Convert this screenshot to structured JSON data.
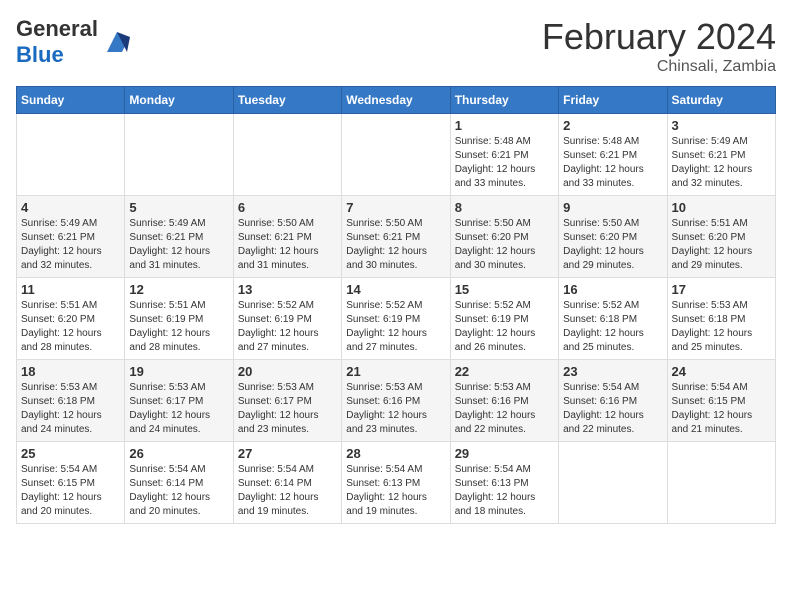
{
  "header": {
    "logo_general": "General",
    "logo_blue": "Blue",
    "month_title": "February 2024",
    "subtitle": "Chinsali, Zambia"
  },
  "days_of_week": [
    "Sunday",
    "Monday",
    "Tuesday",
    "Wednesday",
    "Thursday",
    "Friday",
    "Saturday"
  ],
  "weeks": [
    [
      {
        "day": "",
        "info": ""
      },
      {
        "day": "",
        "info": ""
      },
      {
        "day": "",
        "info": ""
      },
      {
        "day": "",
        "info": ""
      },
      {
        "day": "1",
        "info": "Sunrise: 5:48 AM\nSunset: 6:21 PM\nDaylight: 12 hours\nand 33 minutes."
      },
      {
        "day": "2",
        "info": "Sunrise: 5:48 AM\nSunset: 6:21 PM\nDaylight: 12 hours\nand 33 minutes."
      },
      {
        "day": "3",
        "info": "Sunrise: 5:49 AM\nSunset: 6:21 PM\nDaylight: 12 hours\nand 32 minutes."
      }
    ],
    [
      {
        "day": "4",
        "info": "Sunrise: 5:49 AM\nSunset: 6:21 PM\nDaylight: 12 hours\nand 32 minutes."
      },
      {
        "day": "5",
        "info": "Sunrise: 5:49 AM\nSunset: 6:21 PM\nDaylight: 12 hours\nand 31 minutes."
      },
      {
        "day": "6",
        "info": "Sunrise: 5:50 AM\nSunset: 6:21 PM\nDaylight: 12 hours\nand 31 minutes."
      },
      {
        "day": "7",
        "info": "Sunrise: 5:50 AM\nSunset: 6:21 PM\nDaylight: 12 hours\nand 30 minutes."
      },
      {
        "day": "8",
        "info": "Sunrise: 5:50 AM\nSunset: 6:20 PM\nDaylight: 12 hours\nand 30 minutes."
      },
      {
        "day": "9",
        "info": "Sunrise: 5:50 AM\nSunset: 6:20 PM\nDaylight: 12 hours\nand 29 minutes."
      },
      {
        "day": "10",
        "info": "Sunrise: 5:51 AM\nSunset: 6:20 PM\nDaylight: 12 hours\nand 29 minutes."
      }
    ],
    [
      {
        "day": "11",
        "info": "Sunrise: 5:51 AM\nSunset: 6:20 PM\nDaylight: 12 hours\nand 28 minutes."
      },
      {
        "day": "12",
        "info": "Sunrise: 5:51 AM\nSunset: 6:19 PM\nDaylight: 12 hours\nand 28 minutes."
      },
      {
        "day": "13",
        "info": "Sunrise: 5:52 AM\nSunset: 6:19 PM\nDaylight: 12 hours\nand 27 minutes."
      },
      {
        "day": "14",
        "info": "Sunrise: 5:52 AM\nSunset: 6:19 PM\nDaylight: 12 hours\nand 27 minutes."
      },
      {
        "day": "15",
        "info": "Sunrise: 5:52 AM\nSunset: 6:19 PM\nDaylight: 12 hours\nand 26 minutes."
      },
      {
        "day": "16",
        "info": "Sunrise: 5:52 AM\nSunset: 6:18 PM\nDaylight: 12 hours\nand 25 minutes."
      },
      {
        "day": "17",
        "info": "Sunrise: 5:53 AM\nSunset: 6:18 PM\nDaylight: 12 hours\nand 25 minutes."
      }
    ],
    [
      {
        "day": "18",
        "info": "Sunrise: 5:53 AM\nSunset: 6:18 PM\nDaylight: 12 hours\nand 24 minutes."
      },
      {
        "day": "19",
        "info": "Sunrise: 5:53 AM\nSunset: 6:17 PM\nDaylight: 12 hours\nand 24 minutes."
      },
      {
        "day": "20",
        "info": "Sunrise: 5:53 AM\nSunset: 6:17 PM\nDaylight: 12 hours\nand 23 minutes."
      },
      {
        "day": "21",
        "info": "Sunrise: 5:53 AM\nSunset: 6:16 PM\nDaylight: 12 hours\nand 23 minutes."
      },
      {
        "day": "22",
        "info": "Sunrise: 5:53 AM\nSunset: 6:16 PM\nDaylight: 12 hours\nand 22 minutes."
      },
      {
        "day": "23",
        "info": "Sunrise: 5:54 AM\nSunset: 6:16 PM\nDaylight: 12 hours\nand 22 minutes."
      },
      {
        "day": "24",
        "info": "Sunrise: 5:54 AM\nSunset: 6:15 PM\nDaylight: 12 hours\nand 21 minutes."
      }
    ],
    [
      {
        "day": "25",
        "info": "Sunrise: 5:54 AM\nSunset: 6:15 PM\nDaylight: 12 hours\nand 20 minutes."
      },
      {
        "day": "26",
        "info": "Sunrise: 5:54 AM\nSunset: 6:14 PM\nDaylight: 12 hours\nand 20 minutes."
      },
      {
        "day": "27",
        "info": "Sunrise: 5:54 AM\nSunset: 6:14 PM\nDaylight: 12 hours\nand 19 minutes."
      },
      {
        "day": "28",
        "info": "Sunrise: 5:54 AM\nSunset: 6:13 PM\nDaylight: 12 hours\nand 19 minutes."
      },
      {
        "day": "29",
        "info": "Sunrise: 5:54 AM\nSunset: 6:13 PM\nDaylight: 12 hours\nand 18 minutes."
      },
      {
        "day": "",
        "info": ""
      },
      {
        "day": "",
        "info": ""
      }
    ]
  ]
}
